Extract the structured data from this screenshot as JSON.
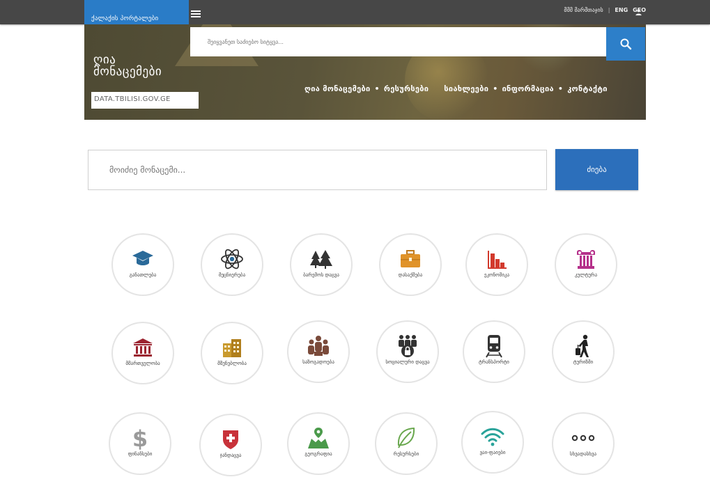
{
  "topbar": {
    "login_link": "მმმ მარმთაჯის",
    "separator": "|",
    "lang_en": "ENG",
    "lang_ge": "GEO"
  },
  "brand": {
    "portal_label": "ქალაქის პორტალები"
  },
  "top_search": {
    "placeholder": "შეიყვანეთ საძიებო სიტყვა..."
  },
  "site": {
    "title_line1": "ღია",
    "title_line2": "მონაცემები",
    "domain": "DATA.TBILISI.GOV.GE"
  },
  "hero_nav": {
    "items": [
      "ღია მონაცემები",
      "რესურსები",
      "სიახლეები",
      "ინფორმაცია",
      "კონტაქტი"
    ],
    "bullet": "•"
  },
  "main_search": {
    "placeholder": "მოიძიე მონაცემი...",
    "button": "ძიება"
  },
  "categories": [
    {
      "label": "განათლება",
      "icon": "graduation-cap-icon",
      "color": "#2a6a99"
    },
    {
      "label": "მეცნიერება",
      "icon": "atom-icon",
      "color": "#333333"
    },
    {
      "label": "ბარემოს დაცვა",
      "icon": "trees-icon",
      "color": "#333333"
    },
    {
      "label": "დასაქმება",
      "icon": "briefcase-icon",
      "color": "#e0932a"
    },
    {
      "label": "ეკონომიკა",
      "icon": "bar-chart-icon",
      "color": "#d23a2d"
    },
    {
      "label": "კულტურა",
      "icon": "column-icon",
      "color": "#b5308a"
    },
    {
      "label": "მმართველობა",
      "icon": "government-building-icon",
      "color": "#9b2330"
    },
    {
      "label": "მშენებლობა",
      "icon": "buildings-icon",
      "color": "#c99a2e"
    },
    {
      "label": "საზოგადოება",
      "icon": "people-group-icon",
      "color": "#7a4a3a"
    },
    {
      "label": "სოციალური დაცვა",
      "icon": "people-lock-icon",
      "color": "#333333"
    },
    {
      "label": "ტრანსპორტი",
      "icon": "train-icon",
      "color": "#333333"
    },
    {
      "label": "ტურიზმი",
      "icon": "traveler-icon",
      "color": "#222222"
    },
    {
      "label": "ფინანსები",
      "icon": "dollar-icon",
      "color": "#9a9a9a"
    },
    {
      "label": "ჯანდაცვა",
      "icon": "medical-shield-icon",
      "color": "#c8323a"
    },
    {
      "label": "გეოგრაფია",
      "icon": "map-pin-icon",
      "color": "#4a9a4a"
    },
    {
      "label": "რესურსები",
      "icon": "leaf-icon",
      "color": "#6aa84f"
    },
    {
      "label": "ვაი-ფაიები",
      "icon": "wifi-icon",
      "color": "#2aa39a"
    },
    {
      "label": "სხვადასხვა",
      "icon": "more-dots-icon",
      "color": "#333333"
    }
  ]
}
